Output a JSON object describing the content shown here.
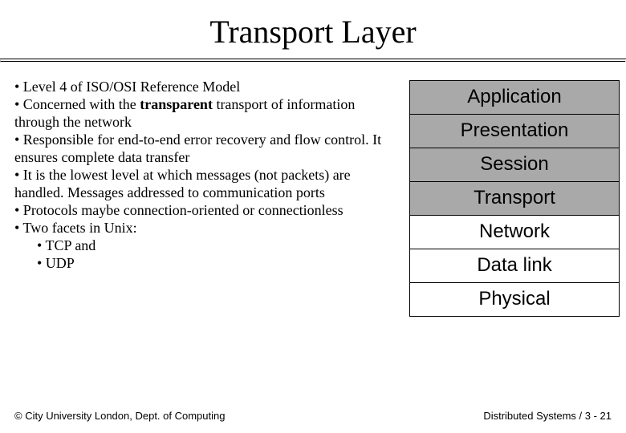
{
  "title": "Transport Layer",
  "bullets": {
    "b0": "• Level 4 of ISO/OSI Reference Model",
    "b1a": "• Concerned with the ",
    "b1b": "transparent",
    "b1c": " transport of information through the network",
    "b2": "• Responsible for end-to-end error recovery and flow control. It ensures complete data transfer",
    "b3": "• It is the lowest level at which messages (not packets) are handled. Messages addressed to communication ports",
    "b4": "• Protocols maybe connection-oriented or connectionless",
    "b5": "• Two facets in Unix:",
    "b5a": "• TCP and",
    "b5b": "• UDP"
  },
  "osi": {
    "l7": "Application",
    "l6": "Presentation",
    "l5": "Session",
    "l4": "Transport",
    "l3": "Network",
    "l2": "Data link",
    "l1": "Physical"
  },
  "footer": {
    "left": "© City University London, Dept. of Computing",
    "right": "Distributed Systems / 3 - 21"
  }
}
